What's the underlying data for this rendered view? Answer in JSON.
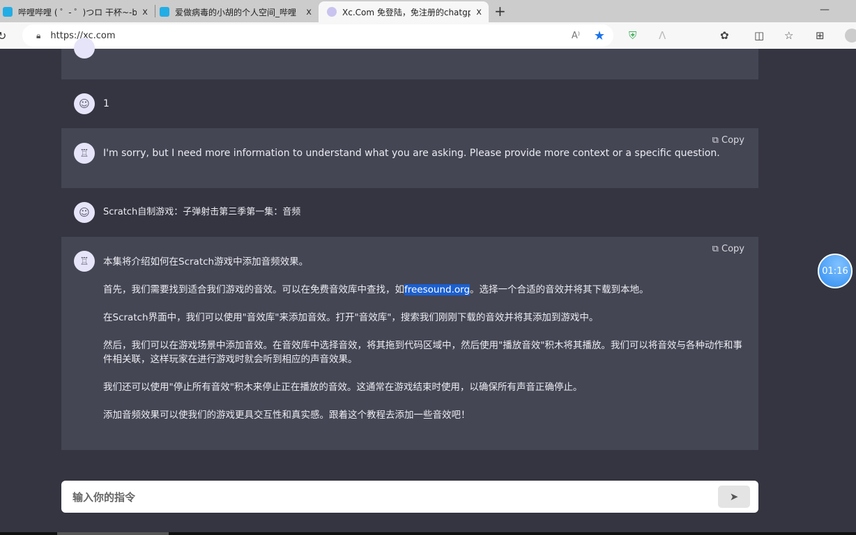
{
  "browser": {
    "tabs": [
      {
        "title": "哔哩哔哩 ( ゜- ゜)つロ 干杯~-bilib",
        "icon": "bilibili-icon"
      },
      {
        "title": "爱做病毒的小胡的个人空间_哔哩",
        "icon": "bilibili-icon"
      },
      {
        "title": "Xc.Com 免登陆，免注册的chatgp",
        "icon": "chat-icon",
        "active": true
      }
    ],
    "close_glyph": "x",
    "new_tab": "+",
    "minimize": "—",
    "url": "https://xc.com",
    "read_aloud": "A⁾"
  },
  "chat": {
    "messages": [
      {
        "role": "user",
        "text": "1"
      },
      {
        "role": "assistant",
        "copy": "Copy",
        "paragraphs": [
          "I'm sorry, but I need more information to understand what you are asking. Please provide more context or a specific question."
        ]
      },
      {
        "role": "user",
        "text": "Scratch自制游戏：子弹射击第三季第一集：音频"
      },
      {
        "role": "assistant",
        "copy": "Copy",
        "intro": "本集将介绍如何在Scratch游戏中添加音频效果。",
        "p1_before": "首先，我们需要找到适合我们游戏的音效。可以在免费音效库中查找，如",
        "p1_link": "freesound.org",
        "p1_after": "。选择一个合适的音效并将其下载到本地。",
        "p2": "在Scratch界面中，我们可以使用\"音效库\"来添加音效。打开\"音效库\"，搜索我们刚刚下载的音效并将其添加到游戏中。",
        "p3": "然后，我们可以在游戏场景中添加音效。在音效库中选择音效，将其拖到代码区域中，然后使用\"播放音效\"积木将其播放。我们可以将音效与各种动作和事件相关联，这样玩家在进行游戏时就会听到相应的声音效果。",
        "p4": "我们还可以使用\"停止所有音效\"积木来停止正在播放的音效。这通常在游戏结束时使用，以确保所有声音正确停止。",
        "p5": "添加音频效果可以使我们的游戏更具交互性和真实感。跟着这个教程去添加一些音效吧！"
      }
    ]
  },
  "timer": "01:16",
  "input": {
    "placeholder": "输入你的指令"
  },
  "colors": {
    "background": "#343541",
    "assistant_bg": "#444654",
    "link_highlight": "#1a5fd0"
  }
}
